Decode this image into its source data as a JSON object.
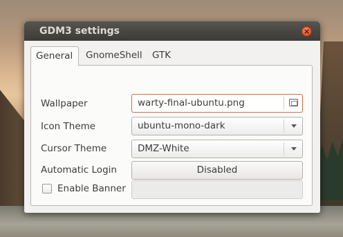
{
  "window": {
    "title": "GDM3 settings",
    "close_symbol": "×"
  },
  "tabs": [
    {
      "label": "General",
      "active": true
    },
    {
      "label": "GnomeShell",
      "active": false
    },
    {
      "label": "GTK",
      "active": false
    }
  ],
  "general": {
    "wallpaper": {
      "label": "Wallpaper",
      "value": "warty-final-ubuntu.png",
      "icon": "file-chooser-icon"
    },
    "icon_theme": {
      "label": "Icon Theme",
      "value": "ubuntu-mono-dark"
    },
    "cursor_theme": {
      "label": "Cursor Theme",
      "value": "DMZ-White"
    },
    "automatic_login": {
      "label": "Automatic Login",
      "value": "Disabled"
    },
    "enable_banner": {
      "label": "Enable Banner",
      "checked": false,
      "value": ""
    }
  },
  "colors": {
    "accent": "#d46a3e",
    "close_button": "#df4a1e",
    "titlebar": "#3c3b37"
  }
}
